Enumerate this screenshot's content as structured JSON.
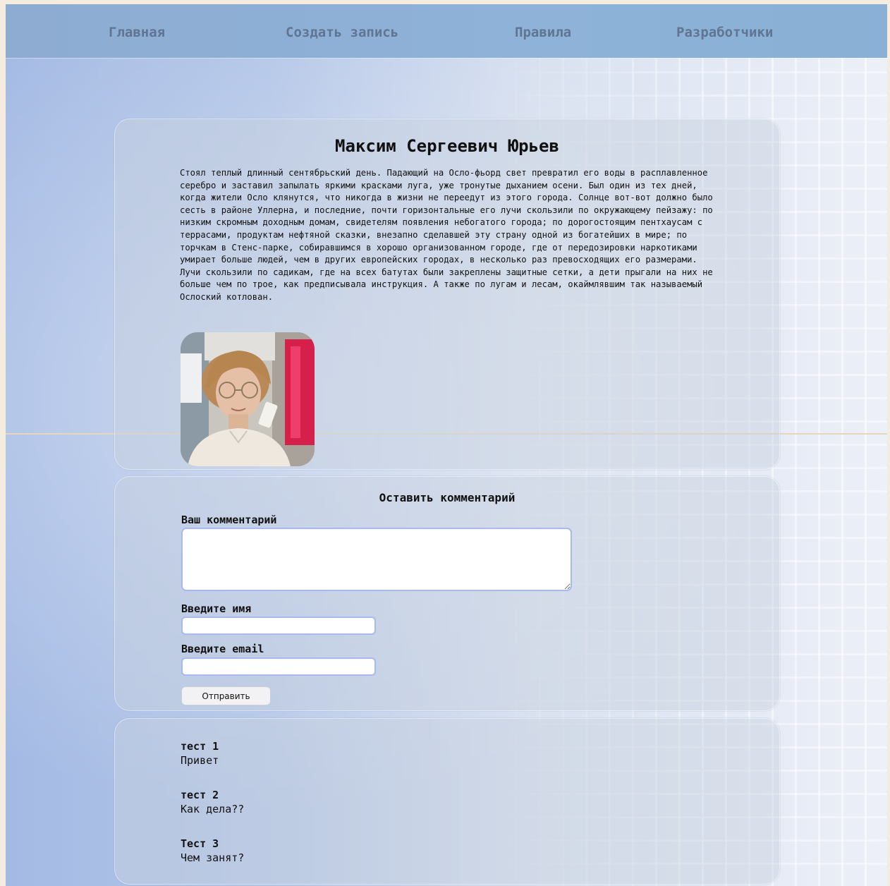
{
  "nav": {
    "items": [
      "Главная",
      "Создать запись",
      "Правила",
      "Разработчики"
    ]
  },
  "post": {
    "title": "Максим Сергеевич Юрьев",
    "body": "Стоял теплый длинный сентябрьский день. Падающий на Осло-фьорд свет превратил его воды в расплавленное серебро и заставил запылать яркими красками луга, уже тронутые дыханием осени. Был один из тех дней, когда жители Осло клянутся, что никогда в жизни не переедут из этого города. Солнце вот-вот должно было сесть в районе Уллерна, и последние, почти горизонтальные его лучи скользили по окружающему пейзажу: по низким скромным доходным домам, свидетелям появления небогатого города; по дорогостоящим пентхаусам с террасами, продуктам нефтяной сказки, внезапно сделавшей эту страну одной из богатейших в мире; по торчкам в Стенс-парке, собиравшимся в хорошо организованном городе, где от передозировки наркотиками умирает больше людей, чем в других европейских городах, в несколько раз превосходящих его размерами. Лучи скользили по садикам, где на всех батутах были закреплены защитные сетки, а дети прыгали на них не больше чем по трое, как предписывала инструкция. А также по лугам и лесам, окаймлявшим так называемый Ослоский котлован."
  },
  "comment_form": {
    "title": "Оставить комментарий",
    "comment_label": "Ваш комментарий",
    "name_label": "Введите имя",
    "email_label": "Введите email",
    "submit_label": "Отправить"
  },
  "comments": [
    {
      "author": "тест 1",
      "text": "Привет"
    },
    {
      "author": "тест 2",
      "text": "Как дела??"
    },
    {
      "author": "Тест 3",
      "text": "Чем занят?"
    }
  ]
}
